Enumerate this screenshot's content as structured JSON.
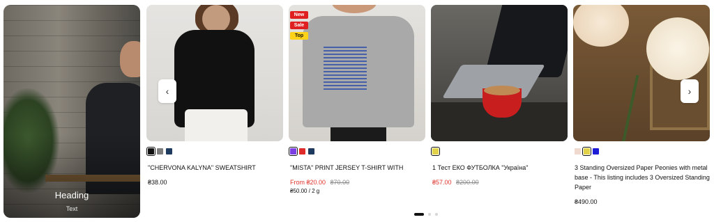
{
  "promo": {
    "heading": "Heading",
    "text": "Text"
  },
  "products": [
    {
      "name": "\"CHERVONA KALYNA\" SWEATSHIRT",
      "price": "₴38.00",
      "swatches": [
        "#111111",
        "#7d7d7d",
        "#1f3a5f"
      ],
      "selected_swatch": 0
    },
    {
      "name": "\"MISTA\" PRINT JERSEY T-SHIRT WITH",
      "badges": [
        "New",
        "Sale",
        "Top"
      ],
      "price_sale": "From ₴20.00",
      "price_old": "₴70.00",
      "unit_price": "₴50.00 / 2 g",
      "swatches": [
        "#7b3fe4",
        "#e02b2b",
        "#1f3a5f"
      ],
      "selected_swatch": 0
    },
    {
      "name": "1 Тест ЕКО ФУТБОЛКА \"Україна\"",
      "price_sale": "₴57.00",
      "price_old": "₴200.00",
      "swatches": [
        "#e2d24a"
      ],
      "selected_swatch": 0
    },
    {
      "name": "3 Standing Oversized Paper Peonies with metal base - This listing includes 3 Oversized Standing Paper",
      "price": "₴490.00",
      "swatches": [
        "#f0d9cf",
        "#e2d24a",
        "#1d1dd8"
      ],
      "selected_swatch": 1
    }
  ],
  "controls": {
    "prev_icon": "‹",
    "next_icon": "›"
  },
  "pagination": {
    "count": 3,
    "active": 0
  }
}
